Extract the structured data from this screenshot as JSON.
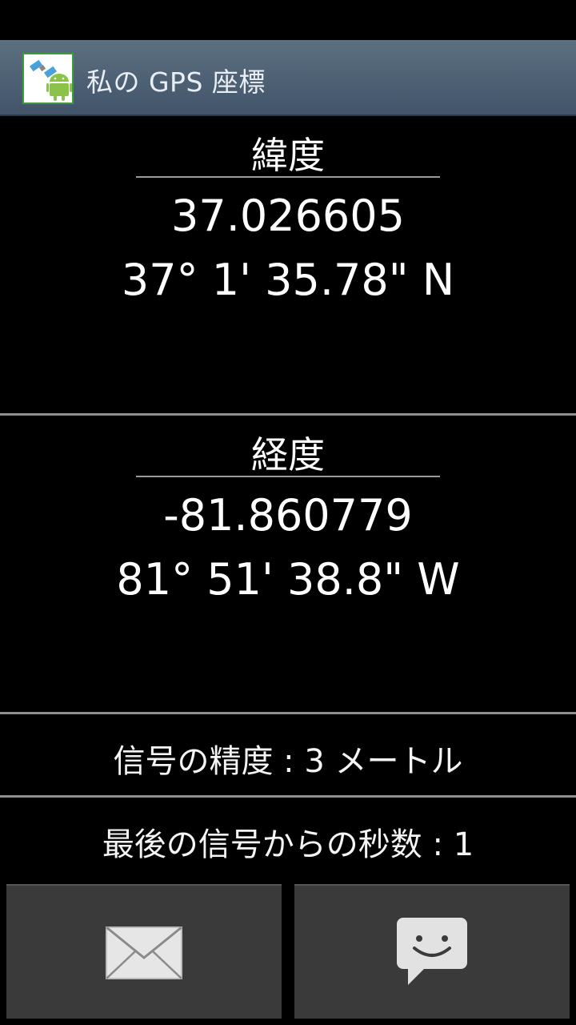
{
  "app": {
    "title": "私の GPS 座標",
    "icon": "gps-android-app-icon",
    "accent": "#3d9a3d"
  },
  "latitude": {
    "label": "緯度",
    "decimal": "37.026605",
    "dms": "37° 1' 35.78\" N"
  },
  "longitude": {
    "label": "経度",
    "decimal": "-81.860779",
    "dms": "81° 51' 38.8\" W"
  },
  "accuracy": {
    "text": "信号の精度 : 3 メートル"
  },
  "last_fix": {
    "text": "最後の信号からの秒数 : 1"
  },
  "buttons": {
    "email_icon": "envelope-icon",
    "sms_icon": "chat-bubble-smiley-icon"
  }
}
